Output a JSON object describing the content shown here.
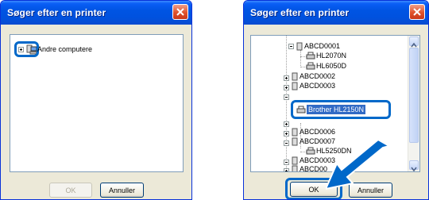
{
  "left_dialog": {
    "title": "Søger efter en printer",
    "tree_item": "Andre computere",
    "ok_label": "OK",
    "cancel_label": "Annuller"
  },
  "right_dialog": {
    "title": "Søger efter en printer",
    "tree": [
      "ABCD0001",
      "HL2070N",
      "HL6050D",
      "ABCD0002",
      "ABCD0003",
      "Brother HL2150N",
      "ABCD0006",
      "ABCD0007",
      "HL5250DN",
      "ABCD0003",
      "ABCD00"
    ],
    "ok_label": "OK",
    "cancel_label": "Annuller"
  },
  "colors": {
    "accent": "#0068c9",
    "titlebar": "#0054e3",
    "selection": "#316ac5"
  }
}
